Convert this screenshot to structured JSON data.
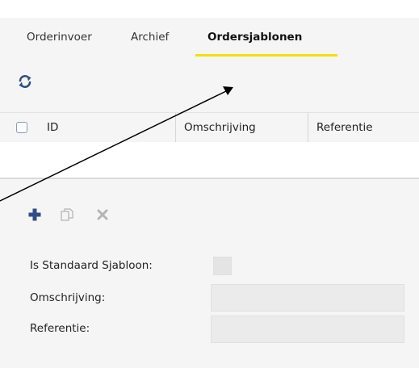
{
  "tabs": [
    {
      "label": "Orderinvoer",
      "active": false
    },
    {
      "label": "Archief",
      "active": false
    },
    {
      "label": "Ordersjablonen",
      "active": true
    }
  ],
  "colors": {
    "accent_underline": "#f2e100",
    "toolbar_icon": "#2e4f86"
  },
  "grid": {
    "refresh_icon": "refresh-icon",
    "columns": [
      "ID",
      "Omschrijving",
      "Referentie"
    ],
    "rows": []
  },
  "form": {
    "toolbar_icons": [
      "plus-icon",
      "copy-icon",
      "delete-icon"
    ],
    "fields": [
      {
        "label": "Is Standaard Sjabloon:",
        "type": "checkbox",
        "checked": false
      },
      {
        "label": "Omschrijving:",
        "type": "text",
        "value": ""
      },
      {
        "label": "Referentie:",
        "type": "text",
        "value": ""
      }
    ]
  }
}
